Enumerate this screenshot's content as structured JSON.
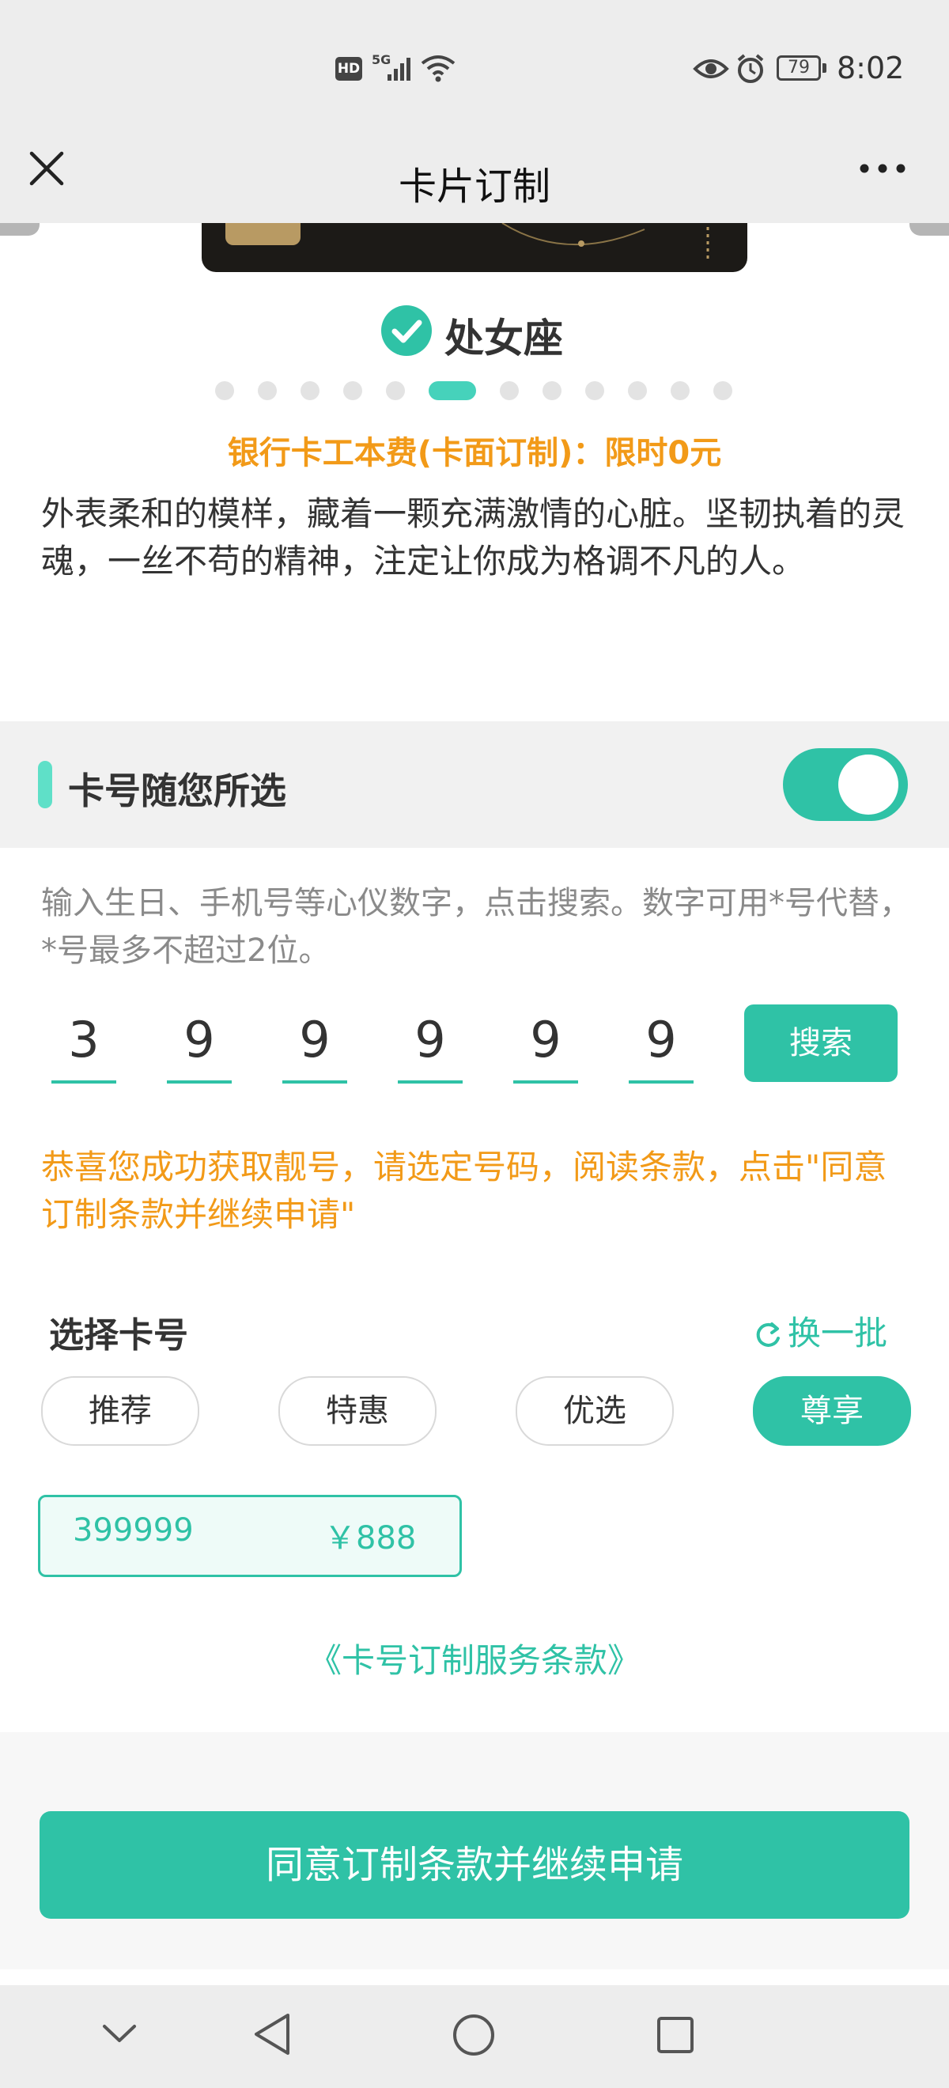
{
  "status_bar": {
    "time": "8:02",
    "battery": "79",
    "network": "5G",
    "hd": "HD",
    "icons": [
      "hd-icon",
      "signal-icon",
      "wifi-icon",
      "eye-icon",
      "alarm-icon",
      "battery-icon"
    ]
  },
  "nav": {
    "title": "卡片订制",
    "close_icon": "close-icon",
    "more_icon": "more-icon"
  },
  "card": {
    "zodiac": "处女座",
    "carousel_count": 12,
    "carousel_active": 5,
    "fee_text": "银行卡工本费(卡面订制)：限时0元",
    "description": "外表柔和的模样，藏着一颗充满激情的心脏。坚韧执着的灵魂，一丝不苟的精神，注定让你成为格调不凡的人。"
  },
  "number_section": {
    "title": "卡号随您所选",
    "toggle_on": true,
    "hint": "输入生日、手机号等心仪数字，点击搜索。数字可用*号代替，*号最多不超过2位。",
    "digits": [
      "3",
      "9",
      "9",
      "9",
      "9",
      "9"
    ],
    "search_label": "搜索",
    "congrats": "恭喜您成功获取靓号，请选定号码，阅读条款，点击\"同意订制条款并继续申请\"",
    "select_title": "选择卡号",
    "refresh_label": "换一批",
    "tabs": [
      {
        "label": "推荐",
        "selected": false
      },
      {
        "label": "特惠",
        "selected": false
      },
      {
        "label": "优选",
        "selected": false
      },
      {
        "label": "尊享",
        "selected": true
      }
    ],
    "option": {
      "number": "399999",
      "price": "￥888"
    },
    "terms_link": "《卡号订制服务条款》"
  },
  "footer": {
    "agree_label": "同意订制条款并继续申请"
  },
  "system_nav": {
    "icons": [
      "collapse-icon",
      "back-icon",
      "home-icon",
      "recents-icon"
    ]
  },
  "colors": {
    "accent": "#2fc2a6",
    "warning": "#f29a18"
  }
}
